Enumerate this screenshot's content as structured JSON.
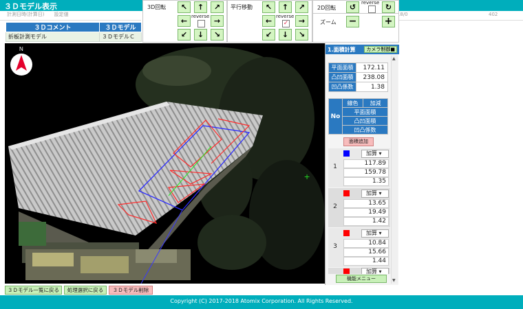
{
  "app": {
    "title": "３Ｄモデル表示"
  },
  "header": {
    "info_left": "計測日時(計算日)　　設定値",
    "info_right_a": "2018/0",
    "info_right_b": "402"
  },
  "comment_table": {
    "headers": [
      "３Ｄコメント",
      "３Ｄモデル"
    ],
    "row": [
      "折板計測モデル",
      "３ＤモデルＣ"
    ]
  },
  "controls": {
    "rotate3d": {
      "label": "3D回転",
      "reverse_label": "reverse",
      "reverse_checked": false,
      "arrows": [
        "↖",
        "↑",
        "↗",
        "←",
        "→",
        "↙",
        "↓",
        "↘"
      ]
    },
    "pan": {
      "label": "平行移動",
      "reverse_label": "reverse",
      "reverse_checked": true,
      "arrows": [
        "↖",
        "↑",
        "↗",
        "←",
        "→",
        "↙",
        "↓",
        "↘"
      ]
    },
    "rotate2d": {
      "label": "2D回転",
      "reverse_label": "reverse",
      "reverse_checked": false,
      "ccw": "↺",
      "cw": "↻"
    },
    "zoom": {
      "label": "ズーム",
      "minus": "−",
      "plus": "+"
    }
  },
  "viewport": {
    "compass_label": "N",
    "crosshair": "+"
  },
  "right_panel": {
    "title": "1.面積計算",
    "camera_button": "カメラ制御■",
    "summary": [
      {
        "label": "平面面積",
        "value": "172.11"
      },
      {
        "label": "凸凹面積",
        "value": "238.08"
      },
      {
        "label": "凹凸係数",
        "value": "1.38"
      }
    ],
    "list_header": {
      "no": "No",
      "line_color": "線色",
      "add_sub": "加減",
      "plan_area": "平面面積",
      "rough_area": "凸凹面積",
      "coef": "凹凸係数"
    },
    "add_area_button": "面積追加",
    "groups": [
      {
        "no": "1",
        "color": "#0000ff",
        "mode": "加算",
        "plan": "117.89",
        "rough": "159.78",
        "coef": "1.35"
      },
      {
        "no": "2",
        "color": "#ff0000",
        "mode": "加算",
        "plan": "13.65",
        "rough": "19.49",
        "coef": "1.42"
      },
      {
        "no": "3",
        "color": "#ff0000",
        "mode": "加算",
        "plan": "10.84",
        "rough": "15.66",
        "coef": "1.44"
      },
      {
        "color": "#ff0000",
        "mode": "加算"
      }
    ],
    "menu_button": "機能メニュー"
  },
  "bottom_buttons": {
    "back_list": "３Ｄモデル一覧に戻る",
    "back_proc": "処理選択に戻る",
    "delete": "３Ｄモデル削除"
  },
  "footer": {
    "copyright": "Copyright (C) 2017-2018 Atomix Corporation. All Rights Reserved."
  },
  "colors": {
    "accent": "#00aebc",
    "header_blue": "#2a79c1",
    "button_green": "#c8f0b8",
    "button_red": "#f7bcbc"
  }
}
